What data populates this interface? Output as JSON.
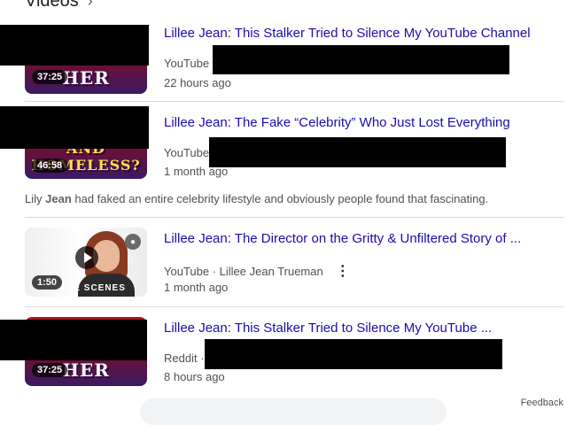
{
  "section": {
    "title": "Videos",
    "chevron_icon": "chevron-right-icon"
  },
  "videos": [
    {
      "title": "Lillee Jean: This Stalker Tried to Silence My YouTube Channel",
      "source": "YouTube",
      "time": "22 hours ago",
      "duration": "37:25",
      "thumb_text": "ER FOR HER"
    },
    {
      "title": "Lillee Jean: The Fake “Celebrity” Who Just Lost Everything",
      "source": "YouTube",
      "time": "1 month ago",
      "duration": "46:58",
      "thumb_text": "AND HOMELESS?",
      "snippet_pre": "Lily ",
      "snippet_bold": "Jean",
      "snippet_post": " had faked an entire celebrity lifestyle and obviously people found that fascinating."
    },
    {
      "title": "Lillee Jean: The Director on the Gritty & Unfiltered Story of ...",
      "source": "YouTube · Lillee Jean Trueman",
      "time": "1 month ago",
      "duration": "1:50",
      "thumb_text": "THE SCENES"
    },
    {
      "title": "Lillee Jean: This Stalker Tried to Silence My YouTube ...",
      "source": "Reddit ·",
      "time": "8 hours ago",
      "duration": "37:25",
      "thumb_text": "ER FOR HER"
    }
  ],
  "footer": {
    "feedback": "Feedback"
  },
  "colors": {
    "link": "#1a0dab",
    "meta": "#4d5156"
  }
}
